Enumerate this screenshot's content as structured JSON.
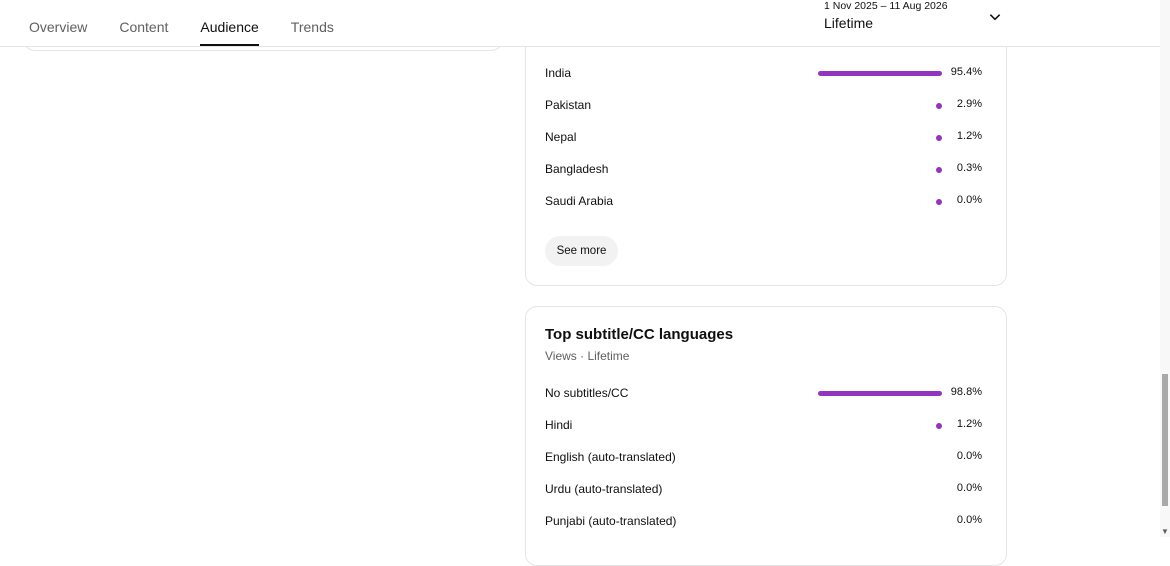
{
  "tabs": [
    {
      "label": "Overview",
      "active": false
    },
    {
      "label": "Content",
      "active": false
    },
    {
      "label": "Audience",
      "active": true
    },
    {
      "label": "Trends",
      "active": false
    }
  ],
  "date_picker": {
    "range": "1 Nov 2025 – 11 Aug 2026",
    "label": "Lifetime",
    "icon": "chevron-down-icon"
  },
  "geography_card": {
    "rows": [
      {
        "label": "India",
        "value": "95.4%",
        "fraction": 0.954
      },
      {
        "label": "Pakistan",
        "value": "2.9%",
        "fraction": 0.029
      },
      {
        "label": "Nepal",
        "value": "1.2%",
        "fraction": 0.012
      },
      {
        "label": "Bangladesh",
        "value": "0.3%",
        "fraction": 0.003
      },
      {
        "label": "Saudi Arabia",
        "value": "0.0%",
        "fraction": 0.0005
      }
    ],
    "see_more_label": "See more"
  },
  "subtitle_card": {
    "title": "Top subtitle/CC languages",
    "subtitle": "Views · Lifetime",
    "rows": [
      {
        "label": "No subtitles/CC",
        "value": "98.8%",
        "fraction": 0.988
      },
      {
        "label": "Hindi",
        "value": "1.2%",
        "fraction": 0.012
      },
      {
        "label": "English (auto-translated)",
        "value": "0.0%",
        "fraction": 0
      },
      {
        "label": "Urdu (auto-translated)",
        "value": "0.0%",
        "fraction": 0
      },
      {
        "label": "Punjabi (auto-translated)",
        "value": "0.0%",
        "fraction": 0
      }
    ]
  },
  "colors": {
    "bar": "#9333c1",
    "text": "#0f0f0f",
    "muted": "#606060",
    "border": "#e5e5e5"
  }
}
